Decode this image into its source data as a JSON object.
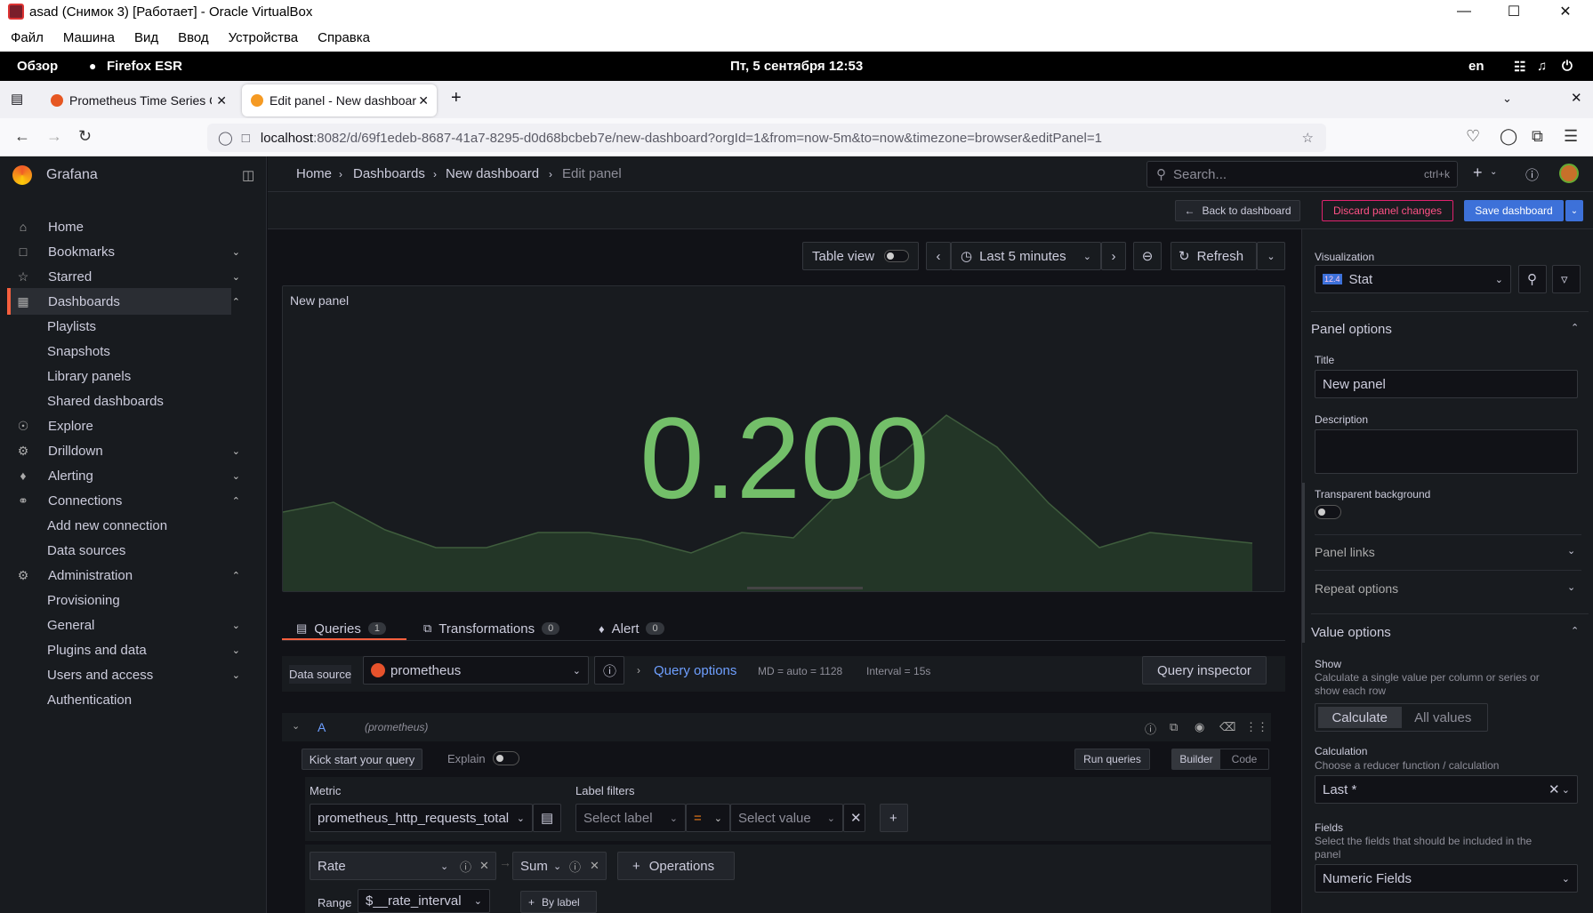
{
  "vbox": {
    "title": "asad (Снимок 3) [Работает] - Oracle VirtualBox",
    "menu": [
      "Файл",
      "Машина",
      "Вид",
      "Ввод",
      "Устройства",
      "Справка"
    ]
  },
  "gnome": {
    "overview": "Обзор",
    "app": "Firefox ESR",
    "clock": "Пт, 5 сентября  12:53",
    "lang": "en"
  },
  "browser": {
    "tabs": [
      {
        "title": "Prometheus Time Series C"
      },
      {
        "title": "Edit panel - New dashboard"
      }
    ],
    "url_host": "localhost",
    "url_rest": ":8082/d/69f1edeb-8687-41a7-8295-d0d68bcbeb7e/new-dashboard?orgId=1&from=now-5m&to=now&timezone=browser&editPanel=1"
  },
  "sidebar": {
    "brand": "Grafana",
    "items": [
      {
        "label": "Home"
      },
      {
        "label": "Bookmarks"
      },
      {
        "label": "Starred"
      },
      {
        "label": "Dashboards"
      },
      {
        "label": "Playlists"
      },
      {
        "label": "Snapshots"
      },
      {
        "label": "Library panels"
      },
      {
        "label": "Shared dashboards"
      },
      {
        "label": "Explore"
      },
      {
        "label": "Drilldown"
      },
      {
        "label": "Alerting"
      },
      {
        "label": "Connections"
      },
      {
        "label": "Add new connection"
      },
      {
        "label": "Data sources"
      },
      {
        "label": "Administration"
      },
      {
        "label": "Provisioning"
      },
      {
        "label": "General"
      },
      {
        "label": "Plugins and data"
      },
      {
        "label": "Users and access"
      },
      {
        "label": "Authentication"
      }
    ]
  },
  "breadcrumb": [
    "Home",
    "Dashboards",
    "New dashboard",
    "Edit panel"
  ],
  "search": {
    "placeholder": "Search...",
    "shortcut": "ctrl+k"
  },
  "actions": {
    "back": "Back to dashboard",
    "discard": "Discard panel changes",
    "save": "Save dashboard"
  },
  "toolbar": {
    "table_view": "Table view",
    "time_range": "Last 5 minutes",
    "refresh": "Refresh"
  },
  "panel": {
    "title": "New panel",
    "value": "0.200",
    "spark": [
      0.3,
      0.37,
      0.17,
      0.04,
      0.04,
      0.15,
      0.15,
      0.1,
      0.0,
      0.15,
      0.11,
      0.47,
      0.68,
      1.0,
      0.77,
      0.36,
      0.04,
      0.15,
      0.11,
      0.07
    ]
  },
  "query_tabs": [
    {
      "label": "Queries",
      "count": "1"
    },
    {
      "label": "Transformations",
      "count": "0"
    },
    {
      "label": "Alert",
      "count": "0"
    }
  ],
  "datasource": {
    "label": "Data source",
    "value": "prometheus",
    "query_options": "Query options",
    "md": "MD = auto = 1128",
    "interval": "Interval = 15s",
    "inspector": "Query inspector"
  },
  "query": {
    "ref": "A",
    "ds": "(prometheus)",
    "kick": "Kick start your query",
    "explain": "Explain",
    "run": "Run queries",
    "builder": "Builder",
    "code": "Code",
    "metric_label": "Metric",
    "metric": "prometheus_http_requests_total",
    "label_filters": "Label filters",
    "select_label": "Select label",
    "op": "=",
    "select_value": "Select value",
    "ops": [
      {
        "name": "Rate"
      },
      {
        "name": "Sum"
      }
    ],
    "operations": "Operations",
    "range_label": "Range",
    "range": "$__rate_interval",
    "by_label": "By label"
  },
  "options": {
    "viz_label": "Visualization",
    "viz": "Stat",
    "viz_version": "12.4",
    "panel_options": "Panel options",
    "title_label": "Title",
    "title_value": "New panel",
    "description_label": "Description",
    "transparent": "Transparent background",
    "panel_links": "Panel links",
    "repeat": "Repeat options",
    "value_options": "Value options",
    "show": "Show",
    "show_desc": "Calculate a single value per column or series or show each row",
    "calculate": "Calculate",
    "all_values": "All values",
    "calculation": "Calculation",
    "calculation_desc": "Choose a reducer function / calculation",
    "calc_value": "Last *",
    "fields": "Fields",
    "fields_desc": "Select the fields that should be included in the panel",
    "fields_value": "Numeric Fields"
  },
  "colors": {
    "value_green": "#73bf69",
    "primary": "#3d71d9",
    "danger": "#e0226e",
    "accent": "#f55f3e"
  }
}
